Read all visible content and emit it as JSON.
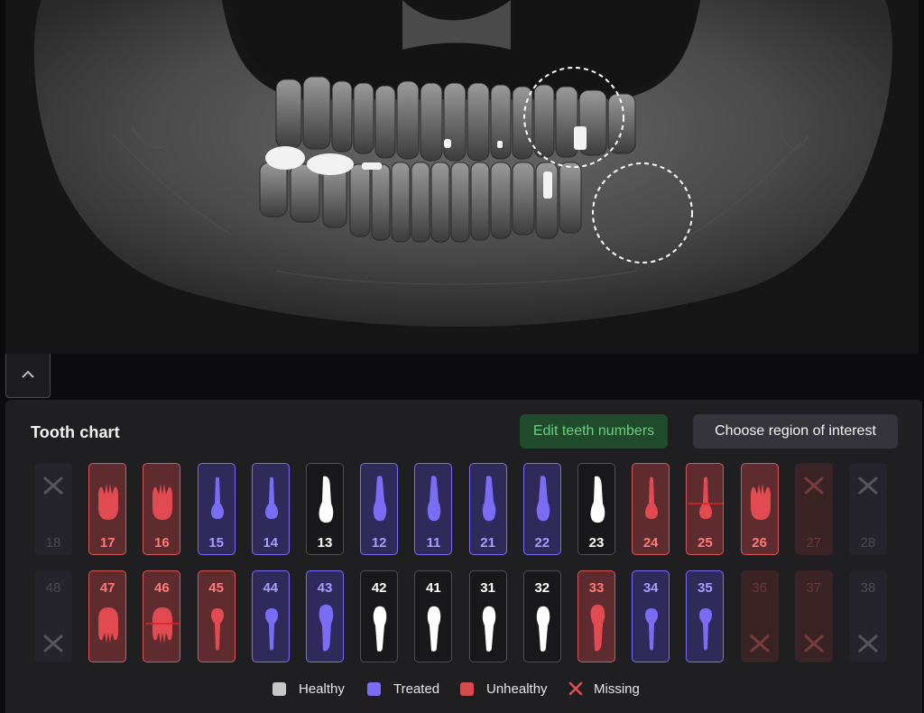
{
  "toggle": {
    "icon": "chevron-up-icon"
  },
  "chart": {
    "title": "Tooth chart",
    "edit_button": "Edit teeth numbers",
    "roi_button": "Choose region of interest"
  },
  "upper_row": [
    {
      "number": "18",
      "status": "missing"
    },
    {
      "number": "17",
      "status": "unhealthy",
      "icon": "molar-icon"
    },
    {
      "number": "16",
      "status": "unhealthy",
      "icon": "molar-icon"
    },
    {
      "number": "15",
      "status": "treated",
      "icon": "premolar-icon"
    },
    {
      "number": "14",
      "status": "treated",
      "icon": "premolar-icon"
    },
    {
      "number": "13",
      "status": "healthy",
      "icon": "canine-icon"
    },
    {
      "number": "12",
      "status": "treated",
      "icon": "incisor-icon"
    },
    {
      "number": "11",
      "status": "treated",
      "icon": "incisor-icon"
    },
    {
      "number": "21",
      "status": "treated",
      "icon": "incisor-icon"
    },
    {
      "number": "22",
      "status": "treated",
      "icon": "incisor-icon"
    },
    {
      "number": "23",
      "status": "healthy",
      "icon": "canine-icon"
    },
    {
      "number": "24",
      "status": "unhealthy",
      "icon": "premolar-icon"
    },
    {
      "number": "25",
      "status": "unhealthy",
      "icon": "premolar-icon"
    },
    {
      "number": "26",
      "status": "unhealthy",
      "icon": "molar-icon"
    },
    {
      "number": "27",
      "status": "missing"
    },
    {
      "number": "28",
      "status": "missing"
    }
  ],
  "lower_row": [
    {
      "number": "48",
      "status": "missing"
    },
    {
      "number": "47",
      "status": "unhealthy",
      "icon": "molar-icon"
    },
    {
      "number": "46",
      "status": "unhealthy",
      "icon": "molar-icon"
    },
    {
      "number": "45",
      "status": "unhealthy",
      "icon": "premolar-icon"
    },
    {
      "number": "44",
      "status": "treated",
      "icon": "premolar-icon"
    },
    {
      "number": "43",
      "status": "treated",
      "icon": "canine-icon"
    },
    {
      "number": "42",
      "status": "healthy",
      "icon": "incisor-icon"
    },
    {
      "number": "41",
      "status": "healthy",
      "icon": "incisor-icon"
    },
    {
      "number": "31",
      "status": "healthy",
      "icon": "incisor-icon"
    },
    {
      "number": "32",
      "status": "healthy",
      "icon": "incisor-icon"
    },
    {
      "number": "33",
      "status": "unhealthy",
      "icon": "canine-icon"
    },
    {
      "number": "34",
      "status": "treated",
      "icon": "premolar-icon"
    },
    {
      "number": "35",
      "status": "treated",
      "icon": "premolar-icon"
    },
    {
      "number": "36",
      "status": "missing"
    },
    {
      "number": "37",
      "status": "missing"
    },
    {
      "number": "38",
      "status": "missing"
    }
  ],
  "legend": [
    {
      "label": "Healthy",
      "color": "#c8c8c8",
      "icon": "square-icon"
    },
    {
      "label": "Treated",
      "color": "#7b6cf5",
      "icon": "square-icon"
    },
    {
      "label": "Unhealthy",
      "color": "#d94a4e",
      "icon": "square-icon"
    },
    {
      "label": "Missing",
      "color": "#e05050",
      "icon": "x-icon"
    }
  ],
  "colors": {
    "healthy": "#ffffff",
    "treated": "#7b6cf5",
    "unhealthy": "#e04a50",
    "missing": "#4a4a50",
    "accent_green": "#66d07a"
  }
}
